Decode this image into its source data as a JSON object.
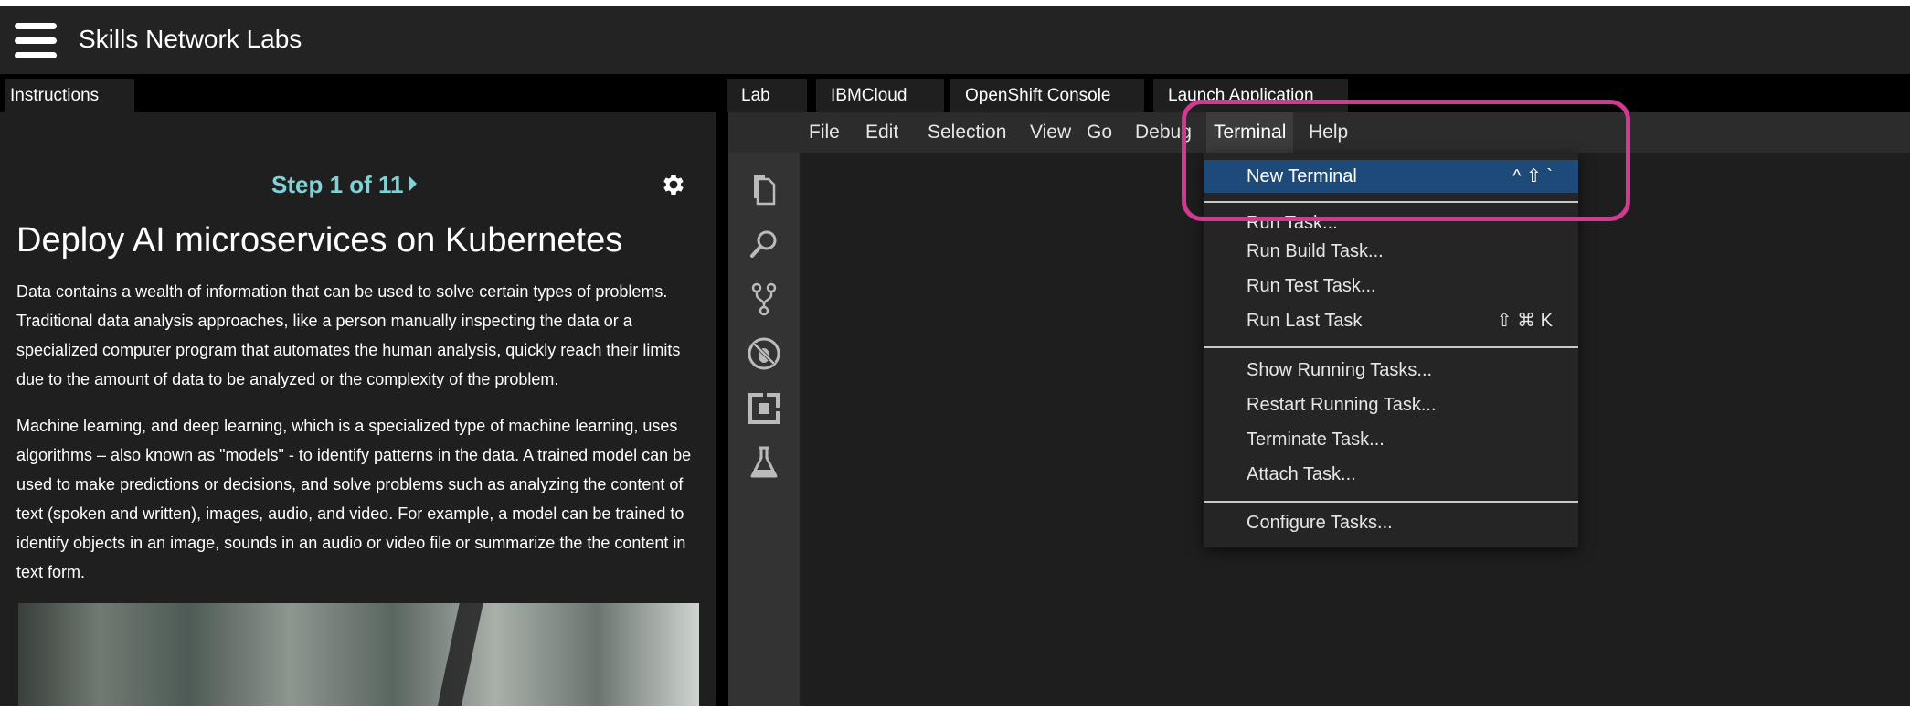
{
  "app": {
    "title": "Skills Network Labs"
  },
  "left_panel": {
    "tab_label": "Instructions",
    "step_label": "Step 1 of 11",
    "title": "Deploy AI microservices on Kubernetes",
    "paragraphs": [
      "Data contains a wealth of information that can be used to solve certain types of problems. Traditional data analysis approaches, like a person manually inspecting the data or a specialized computer program that automates the human analysis, quickly reach their limits due to the amount of data to be analyzed or the complexity of the problem.",
      "Machine learning, and deep learning, which is a specialized type of machine learning, uses algorithms – also known as \"models\" - to identify patterns in the data. A trained model can be used to make predictions or decisions, and solve problems such as analyzing the content of text (spoken and written), images, audio, and video. For example, a model can be trained to identify objects in an image, sounds in an audio or video file or summarize the the content in text form."
    ]
  },
  "ide": {
    "tabs": [
      {
        "label": "Lab"
      },
      {
        "label": "IBMCloud"
      },
      {
        "label": "OpenShift Console"
      },
      {
        "label": "Launch Application"
      }
    ],
    "menu": [
      "File",
      "Edit",
      "Selection",
      "View",
      "Go",
      "Debug",
      "Terminal",
      "Help"
    ],
    "active_menu": "Terminal",
    "activity_icons": [
      "files-icon",
      "search-icon",
      "source-control-icon",
      "debug-icon",
      "extensions-icon",
      "flask-icon"
    ],
    "terminal_menu": {
      "items": [
        {
          "label": "New Terminal",
          "shortcut": "^ ⇧ `"
        },
        {
          "label": "Run Task..."
        },
        {
          "label": "Run Build Task..."
        },
        {
          "label": "Run Test Task..."
        },
        {
          "label": "Run Last Task",
          "shortcut": "⇧ ⌘ K"
        },
        {
          "label": "Show Running Tasks..."
        },
        {
          "label": "Restart Running Task..."
        },
        {
          "label": "Terminate Task..."
        },
        {
          "label": "Attach Task..."
        },
        {
          "label": "Configure Tasks..."
        }
      ]
    }
  },
  "colors": {
    "accent_step": "#7fd3d6",
    "selection": "#1d4a78",
    "highlight_border": "#d13a8e"
  }
}
